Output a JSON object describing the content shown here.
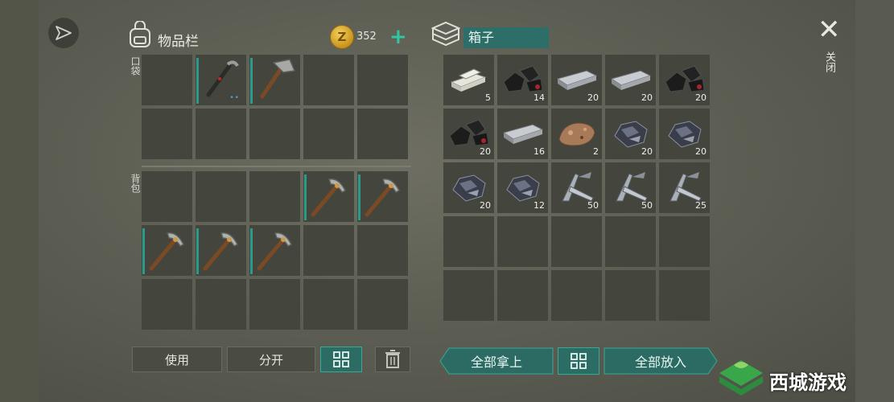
{
  "inventory": {
    "title": "物品栏",
    "coins": "352",
    "pocket_label": "口袋",
    "backpack_label": "背包",
    "pocket_slots": [
      {
        "item": "empty"
      },
      {
        "item": "crowbar",
        "bar": true,
        "dots": "••"
      },
      {
        "item": "hatchet",
        "bar": true
      },
      {
        "item": "empty"
      },
      {
        "item": "empty"
      },
      {
        "item": "empty"
      },
      {
        "item": "empty"
      },
      {
        "item": "empty"
      },
      {
        "item": "empty"
      },
      {
        "item": "empty"
      }
    ],
    "backpack_slots": [
      {
        "item": "empty"
      },
      {
        "item": "empty"
      },
      {
        "item": "empty"
      },
      {
        "item": "pickaxe",
        "bar": true
      },
      {
        "item": "pickaxe",
        "bar": true
      },
      {
        "item": "pickaxe",
        "bar": true
      },
      {
        "item": "pickaxe",
        "bar": true
      },
      {
        "item": "pickaxe",
        "bar": true
      },
      {
        "item": "empty"
      },
      {
        "item": "empty"
      },
      {
        "item": "empty"
      },
      {
        "item": "empty"
      },
      {
        "item": "empty"
      },
      {
        "item": "empty"
      },
      {
        "item": "empty"
      }
    ],
    "buttons": {
      "use": "使用",
      "split": "分开"
    }
  },
  "box": {
    "name": "箱子",
    "slots": [
      {
        "item": "limestone",
        "count": "5"
      },
      {
        "item": "coal",
        "count": "14"
      },
      {
        "item": "iron-ingot",
        "count": "20"
      },
      {
        "item": "iron-ingot",
        "count": "20"
      },
      {
        "item": "coal",
        "count": "20"
      },
      {
        "item": "coal",
        "count": "20"
      },
      {
        "item": "iron-ingot",
        "count": "16"
      },
      {
        "item": "copper-ore",
        "count": "2"
      },
      {
        "item": "iron-ore",
        "count": "20"
      },
      {
        "item": "iron-ore",
        "count": "20"
      },
      {
        "item": "iron-ore",
        "count": "20"
      },
      {
        "item": "iron-ore",
        "count": "12"
      },
      {
        "item": "iron-scrap",
        "count": "50"
      },
      {
        "item": "iron-scrap",
        "count": "50"
      },
      {
        "item": "iron-scrap",
        "count": "25"
      },
      {
        "item": "empty"
      },
      {
        "item": "empty"
      },
      {
        "item": "empty"
      },
      {
        "item": "empty"
      },
      {
        "item": "empty"
      },
      {
        "item": "empty"
      },
      {
        "item": "empty"
      },
      {
        "item": "empty"
      },
      {
        "item": "empty"
      },
      {
        "item": "empty"
      }
    ],
    "buttons": {
      "take_all": "全部拿上",
      "put_all": "全部放入"
    }
  },
  "close": {
    "label": "关闭"
  },
  "watermark": {
    "text": "西城游戏"
  },
  "colors": {
    "accent": "#2fc7a0",
    "teal_button": "#2b6d65",
    "slot_bg": "#44453d"
  }
}
